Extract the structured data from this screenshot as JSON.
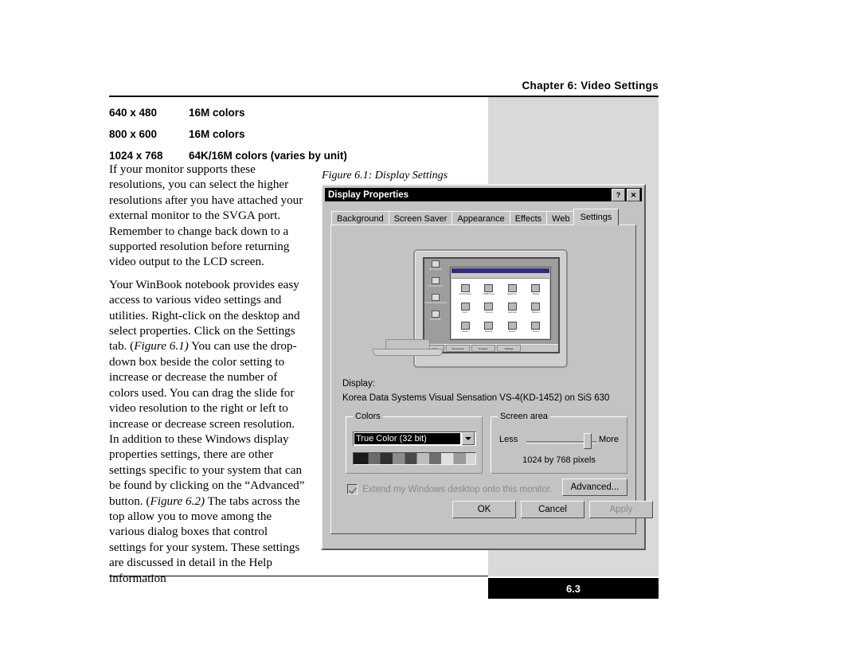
{
  "header": {
    "chapter_title": "Chapter 6: Video Settings"
  },
  "footer": {
    "page_number": "6.3"
  },
  "resolution_table": {
    "rows": [
      {
        "resolution": "640 x 480",
        "colors": "16M colors"
      },
      {
        "resolution": "800 x 600",
        "colors": "16M colors"
      },
      {
        "resolution": "1024 x 768",
        "colors": "64K/16M colors (varies by unit)"
      }
    ]
  },
  "body": {
    "paragraph1": "If your monitor supports these resolutions, you can select the higher resolutions after you have attached your external monitor to the SVGA port. Remember to change back down to a supported resolution before returning video output to the LCD screen.",
    "paragraph2_part1": "Your WinBook notebook provides easy access to various video settings and utilities. Right-click on the desktop and select properties. Click on the Settings tab. (",
    "paragraph2_ref1": "Figure 6.1)",
    "paragraph2_part2": " You can use the drop-down box beside the color setting to increase or decrease the number of colors used. You can drag the slide for video resolution to the right or left to increase or decrease screen resolution. In addition to these Windows display properties settings, there are other settings specific to your system that can be found by clicking on the “Advanced” button. (",
    "paragraph2_ref2": "Figure 6.2)",
    "paragraph2_part3": " The tabs across the top allow you to move among the various dialog boxes that control settings for your system. These settings are discussed in detail in the Help information"
  },
  "figure": {
    "caption": "Figure 6.1: Display Settings"
  },
  "dialog": {
    "title": "Display Properties",
    "help_button": "?",
    "close_button": "✕",
    "tabs": [
      {
        "label": "Background",
        "active": false
      },
      {
        "label": "Screen Saver",
        "active": false
      },
      {
        "label": "Appearance",
        "active": false
      },
      {
        "label": "Effects",
        "active": false
      },
      {
        "label": "Web",
        "active": false
      },
      {
        "label": "Settings",
        "active": true
      }
    ],
    "preview": {
      "desktop_icons": [
        "My Computer",
        "My Documents",
        "Network Neighborhood",
        "Recycle Bin"
      ],
      "folder_icons": [
        "Control Panel",
        "Add/Remove",
        "Date/Time",
        "Display",
        "Fonts",
        "Internet",
        "Keyboard",
        "Modems",
        "Mouse",
        "Network",
        "Printers",
        "System"
      ],
      "taskbar": {
        "start": "Start",
        "items": [
          "Documents",
          "Program",
          "Settings"
        ]
      }
    },
    "display_section": {
      "label": "Display:",
      "value": "Korea Data Systems Visual Sensation VS-4(KD-1452) on SiS 630"
    },
    "colors_group": {
      "title": "Colors",
      "selected": "True Color (32 bit)"
    },
    "screen_area_group": {
      "title": "Screen area",
      "less_label": "Less",
      "more_label": "More",
      "value_label": "1024 by 768 pixels"
    },
    "extend_checkbox": {
      "label": "Extend my Windows desktop onto this monitor.",
      "checked": true
    },
    "buttons": {
      "advanced": "Advanced...",
      "ok": "OK",
      "cancel": "Cancel",
      "apply": "Apply"
    }
  }
}
